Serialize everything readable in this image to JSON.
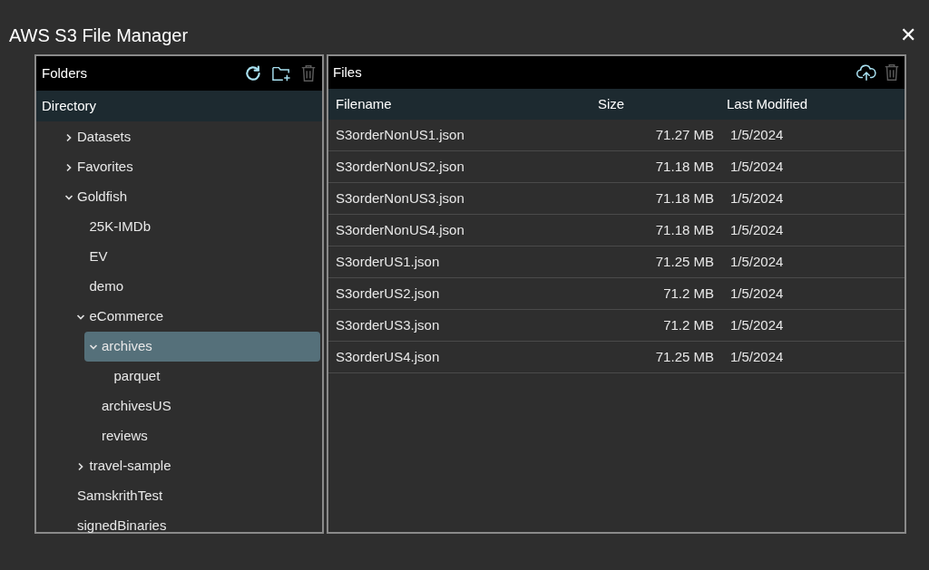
{
  "window": {
    "title": "AWS S3 File Manager",
    "close": "✕"
  },
  "folders": {
    "title": "Folders",
    "delete_disabled": true,
    "root": "Directory",
    "tree": [
      {
        "label": "Datasets",
        "expanded": false,
        "has_children": true,
        "selected": false
      },
      {
        "label": "Favorites",
        "expanded": false,
        "has_children": true,
        "selected": false
      },
      {
        "label": "Goldfish",
        "expanded": true,
        "has_children": true,
        "selected": false,
        "children": [
          {
            "label": "25K-IMDb",
            "expanded": false,
            "has_children": false,
            "selected": false
          },
          {
            "label": "EV",
            "expanded": false,
            "has_children": false,
            "selected": false
          },
          {
            "label": "demo",
            "expanded": false,
            "has_children": false,
            "selected": false
          },
          {
            "label": "eCommerce",
            "expanded": true,
            "has_children": true,
            "selected": false,
            "children": [
              {
                "label": "archives",
                "expanded": true,
                "has_children": true,
                "selected": true,
                "children": [
                  {
                    "label": "parquet",
                    "expanded": false,
                    "has_children": false,
                    "selected": false
                  }
                ]
              },
              {
                "label": "archivesUS",
                "expanded": false,
                "has_children": false,
                "selected": false
              },
              {
                "label": "reviews",
                "expanded": false,
                "has_children": false,
                "selected": false
              }
            ]
          },
          {
            "label": "travel-sample",
            "expanded": false,
            "has_children": true,
            "selected": false
          }
        ]
      },
      {
        "label": "SamskrithTest",
        "expanded": false,
        "has_children": false,
        "selected": false
      },
      {
        "label": "signedBinaries",
        "expanded": false,
        "has_children": false,
        "selected": false
      }
    ]
  },
  "files": {
    "title": "Files",
    "delete_disabled": true,
    "columns": [
      "Filename",
      "Size",
      "Last Modified"
    ],
    "rows": [
      [
        "S3orderNonUS1.json",
        "71.27 MB",
        "1/5/2024"
      ],
      [
        "S3orderNonUS2.json",
        "71.18 MB",
        "1/5/2024"
      ],
      [
        "S3orderNonUS3.json",
        "71.18 MB",
        "1/5/2024"
      ],
      [
        "S3orderNonUS4.json",
        "71.18 MB",
        "1/5/2024"
      ],
      [
        "S3orderUS1.json",
        "71.25 MB",
        "1/5/2024"
      ],
      [
        "S3orderUS2.json",
        "71.2 MB",
        "1/5/2024"
      ],
      [
        "S3orderUS3.json",
        "71.2 MB",
        "1/5/2024"
      ],
      [
        "S3orderUS4.json",
        "71.25 MB",
        "1/5/2024"
      ]
    ]
  }
}
